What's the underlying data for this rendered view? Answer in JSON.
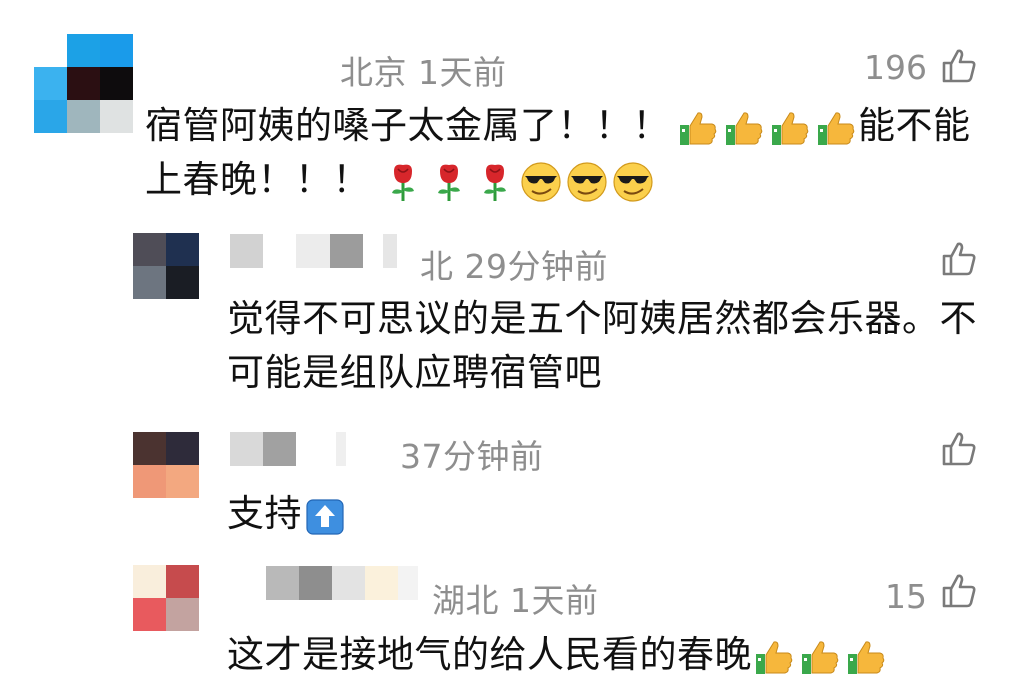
{
  "comments": [
    {
      "location_time": "北京 1天前",
      "likes": "196",
      "text_line1": "宿管阿姨的嗓子太金属了！！！",
      "text_line1_end": "能不能",
      "text_line2": "上春晚！！！",
      "emojis_line1": [
        "thumbs-up-icon",
        "thumbs-up-icon",
        "thumbs-up-icon",
        "thumbs-up-icon"
      ],
      "emojis_line2": [
        "rose-icon",
        "rose-icon",
        "rose-icon",
        "cool-face-icon",
        "cool-face-icon",
        "cool-face-icon"
      ]
    },
    {
      "location_time": "北 29分钟前",
      "likes": "",
      "text_line1": "觉得不可思议的是五个阿姨居然都会乐器。不",
      "text_line2": "可能是组队应聘宿管吧"
    },
    {
      "location_time": "37分钟前",
      "likes": "",
      "text_line1": "支持",
      "emojis_line1": [
        "up-arrow-icon"
      ]
    },
    {
      "location_time": "湖北 1天前",
      "likes": "15",
      "text_line1": "这才是接地气的给人民看的春晚",
      "emojis_line1": [
        "thumbs-up-icon",
        "thumbs-up-icon",
        "thumbs-up-icon"
      ]
    }
  ],
  "colors": {
    "meta_gray": "#8e8e8e",
    "text": "#111111",
    "thumb_yellow": "#f6b73c",
    "cuff_green": "#3aa84b"
  }
}
